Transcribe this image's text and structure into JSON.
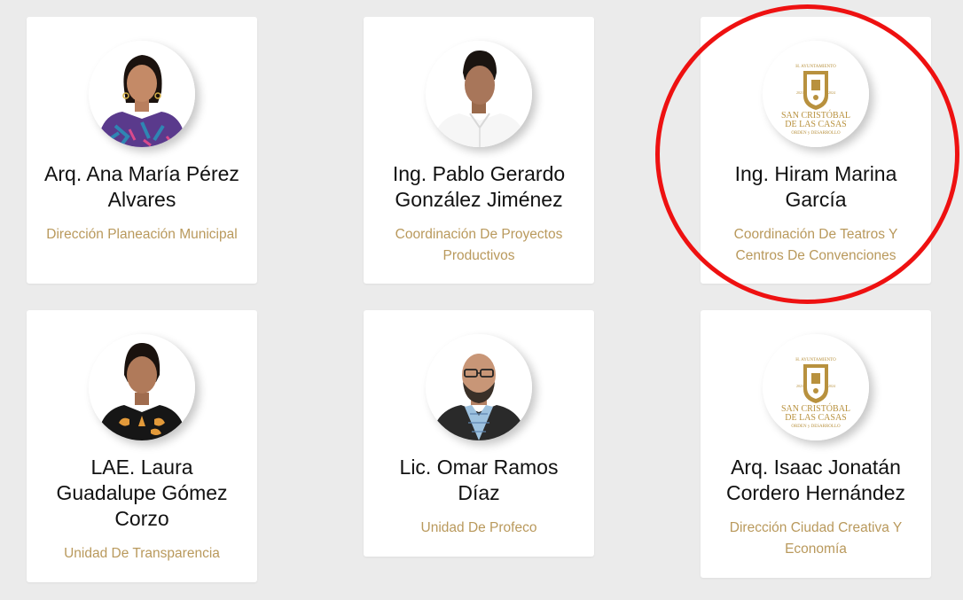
{
  "staff": [
    {
      "name": "Arq. Ana María Pérez Alvares",
      "dept": "Dirección Planeación Municipal",
      "photo": "woman-portrait"
    },
    {
      "name": "Ing. Pablo Gerardo González Jiménez",
      "dept": "Coordinación De Proyectos Productivos",
      "photo": "man-portrait"
    },
    {
      "name": "Ing. Hiram Marina García",
      "dept": "Coordinación De Teatros Y Centros De Convenciones",
      "photo": "municipal-logo"
    },
    {
      "name": "LAE. Laura Guadalupe Gómez Corzo",
      "dept": "Unidad De Transparencia",
      "photo": "woman-portrait"
    },
    {
      "name": "Lic. Omar Ramos Díaz",
      "dept": "Unidad De Profeco",
      "photo": "man-portrait"
    },
    {
      "name": "Arq. Isaac Jonatán Cordero Hernández",
      "dept": "Dirección Ciudad Creativa Y Economía",
      "photo": "municipal-logo"
    }
  ],
  "logo": {
    "top": "H. AYUNTAMIENTO",
    "city_line1": "SAN CRISTÓBAL",
    "city_line2": "DE LAS CASAS",
    "motto": "ORDEN y DESARROLLO",
    "year_left": "2021",
    "year_right": "2024"
  },
  "colors": {
    "background": "#ebebeb",
    "card": "#ffffff",
    "department_text": "#b9995c",
    "logo_gold": "#b8913e",
    "highlight_ring": "#ee1111"
  }
}
